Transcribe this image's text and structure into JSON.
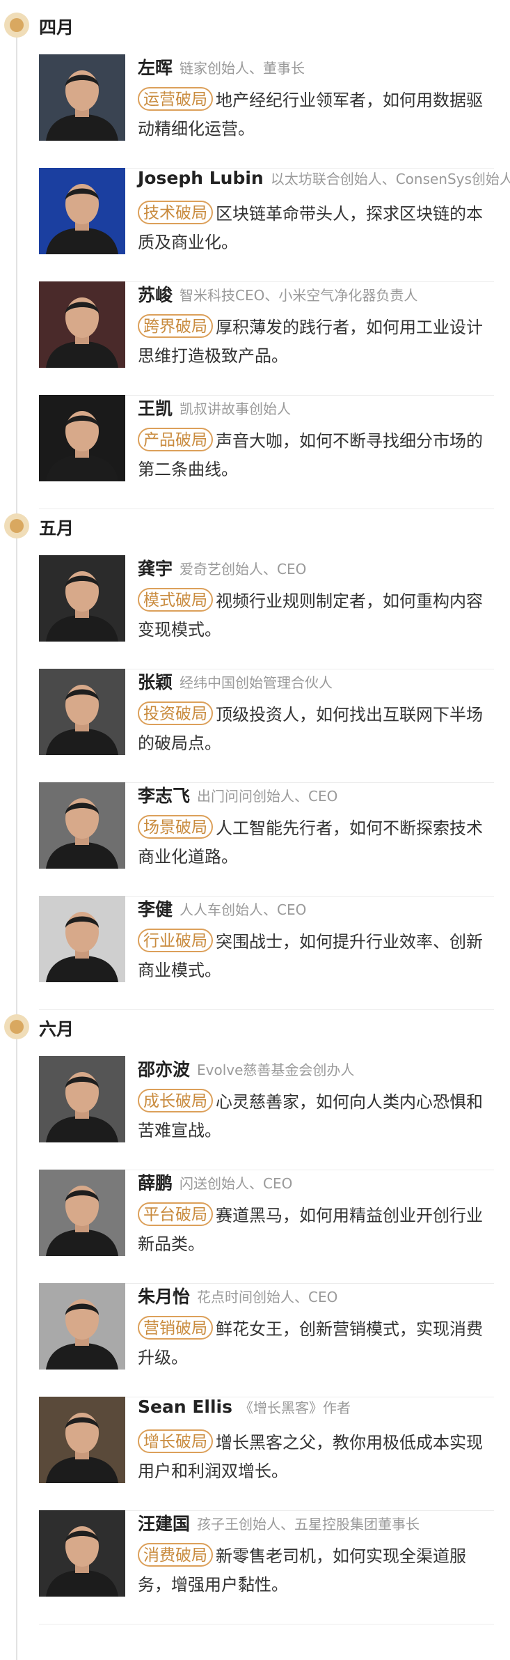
{
  "timeline": [
    {
      "month": "四月",
      "people": [
        {
          "name": "左晖",
          "role": "链家创始人、董事长",
          "tag": "运营破局",
          "desc": "地产经纪行业领军者，如何用数据驱动精细化运营。",
          "bg": "#3a4452"
        },
        {
          "name": "Joseph Lubin",
          "role": "以太坊联合创始人、ConsenSys创始人",
          "tag": "技术破局",
          "desc": "区块链革命带头人，探求区块链的本质及商业化。",
          "bg": "#1b3fa0"
        },
        {
          "name": "苏峻",
          "role": "智米科技CEO、小米空气净化器负责人",
          "tag": "跨界破局",
          "desc": "厚积薄发的践行者，如何用工业设计思维打造极致产品。",
          "bg": "#4a2a2a"
        },
        {
          "name": "王凯",
          "role": "凯叔讲故事创始人",
          "tag": "产品破局",
          "desc": "声音大咖，如何不断寻找细分市场的第二条曲线。",
          "bg": "#1a1a1a"
        }
      ]
    },
    {
      "month": "五月",
      "people": [
        {
          "name": "龚宇",
          "role": "爱奇艺创始人、CEO",
          "tag": "模式破局",
          "desc": "视频行业规则制定者，如何重构内容变现模式。",
          "bg": "#2b2b2b"
        },
        {
          "name": "张颖",
          "role": "经纬中国创始管理合伙人",
          "tag": "投资破局",
          "desc": "顶级投资人，如何找出互联网下半场的破局点。",
          "bg": "#4a4a4a"
        },
        {
          "name": "李志飞",
          "role": "出门问问创始人、CEO",
          "tag": "场景破局",
          "desc": "人工智能先行者，如何不断探索技术商业化道路。",
          "bg": "#6f6f6f"
        },
        {
          "name": "李健",
          "role": "人人车创始人、CEO",
          "tag": "行业破局",
          "desc": "突围战士，如何提升行业效率、创新商业模式。",
          "bg": "#cfcfcf"
        }
      ]
    },
    {
      "month": "六月",
      "people": [
        {
          "name": "邵亦波",
          "role": "Evolve慈善基金会创办人",
          "tag": "成长破局",
          "desc": "心灵慈善家，如何向人类内心恐惧和苦难宣战。",
          "bg": "#555555"
        },
        {
          "name": "薛鹏",
          "role": "闪送创始人、CEO",
          "tag": "平台破局",
          "desc": "赛道黑马，如何用精益创业开创行业新品类。",
          "bg": "#7a7a7a"
        },
        {
          "name": "朱月怡",
          "role": "花点时间创始人、CEO",
          "tag": "营销破局",
          "desc": "鲜花女王，创新营销模式，实现消费升级。",
          "bg": "#a9a9a9"
        },
        {
          "name": "Sean Ellis",
          "role": "《增长黑客》作者",
          "tag": "增长破局",
          "desc": "增长黑客之父，教你用极低成本实现用户和利润双增长。",
          "bg": "#5a4a3a"
        },
        {
          "name": "汪建国",
          "role": "孩子王创始人、五星控股集团董事长",
          "tag": "消费破局",
          "desc": "新零售老司机，如何实现全渠道服务，增强用户黏性。",
          "bg": "#2e2e2e"
        }
      ]
    }
  ]
}
